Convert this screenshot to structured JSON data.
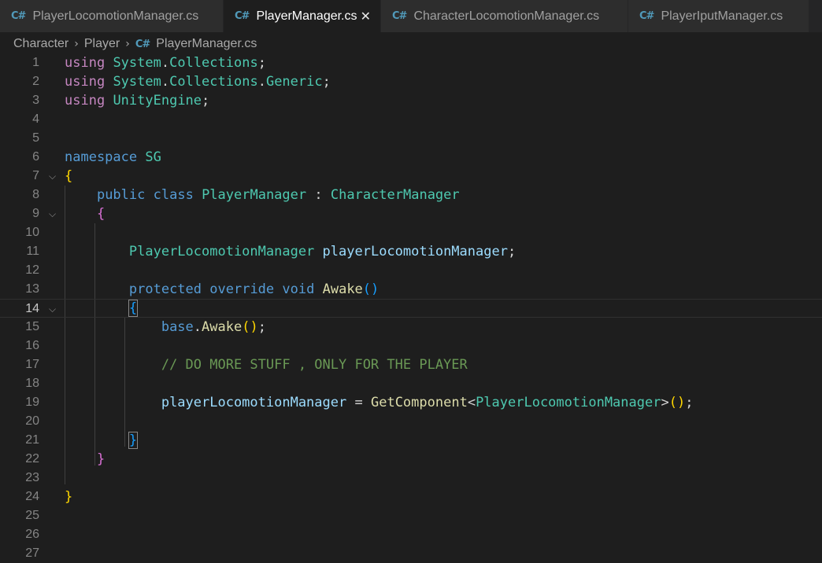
{
  "tabs": [
    {
      "label": "PlayerLocomotionManager.cs",
      "icon": "csharp-icon",
      "active": false
    },
    {
      "label": "PlayerManager.cs",
      "icon": "csharp-icon",
      "active": true
    },
    {
      "label": "CharacterLocomotionManager.cs",
      "icon": "csharp-icon",
      "active": false
    },
    {
      "label": "PlayerIputManager.cs",
      "icon": "csharp-icon",
      "active": false
    }
  ],
  "breadcrumb": {
    "folder1": "Character",
    "folder2": "Player",
    "file": "PlayerManager.cs"
  },
  "csharp_icon_glyph": "C#",
  "close_glyph": "✕",
  "fold_glyph": "⌵",
  "current_line": 14,
  "colors": {
    "keyword": "#569cd6",
    "control": "#c586c0",
    "type": "#4ec9b0",
    "function": "#dcdcaa",
    "variable": "#9cdcfe",
    "comment": "#6a9955",
    "bracket1": "#ffd700",
    "bracket2": "#da70d6",
    "bracket3": "#179fff",
    "background": "#1e1e1e"
  },
  "lines": [
    {
      "n": "1"
    },
    {
      "n": "2"
    },
    {
      "n": "3"
    },
    {
      "n": "4"
    },
    {
      "n": "5"
    },
    {
      "n": "6"
    },
    {
      "n": "7"
    },
    {
      "n": "8"
    },
    {
      "n": "9"
    },
    {
      "n": "10"
    },
    {
      "n": "11"
    },
    {
      "n": "12"
    },
    {
      "n": "13"
    },
    {
      "n": "14"
    },
    {
      "n": "15"
    },
    {
      "n": "16"
    },
    {
      "n": "17"
    },
    {
      "n": "18"
    },
    {
      "n": "19"
    },
    {
      "n": "20"
    },
    {
      "n": "21"
    },
    {
      "n": "22"
    },
    {
      "n": "23"
    },
    {
      "n": "24"
    },
    {
      "n": "25"
    },
    {
      "n": "26"
    },
    {
      "n": "27"
    }
  ],
  "code": {
    "using": "using",
    "system": "System",
    "dot": ".",
    "collections": "Collections",
    "generic": "Generic",
    "semi": ";",
    "unityengine": "UnityEngine",
    "namespace": "namespace",
    "sg": "SG",
    "lbrace": "{",
    "rbrace": "}",
    "public": "public",
    "class": "class",
    "playermanager": "PlayerManager",
    "colon": ":",
    "charactermanager": "CharacterManager",
    "plm_type": "PlayerLocomotionManager",
    "plm_var": "playerLocomotionManager",
    "protected": "protected",
    "override": "override",
    "void": "void",
    "awake": "Awake",
    "parens": "()",
    "base": "base",
    "lparen": "(",
    "rparen": ")",
    "comment": "// DO MORE STUFF , ONLY FOR THE PLAYER",
    "equals": "=",
    "getcomponent": "GetComponent",
    "lt": "<",
    "gt": ">"
  }
}
